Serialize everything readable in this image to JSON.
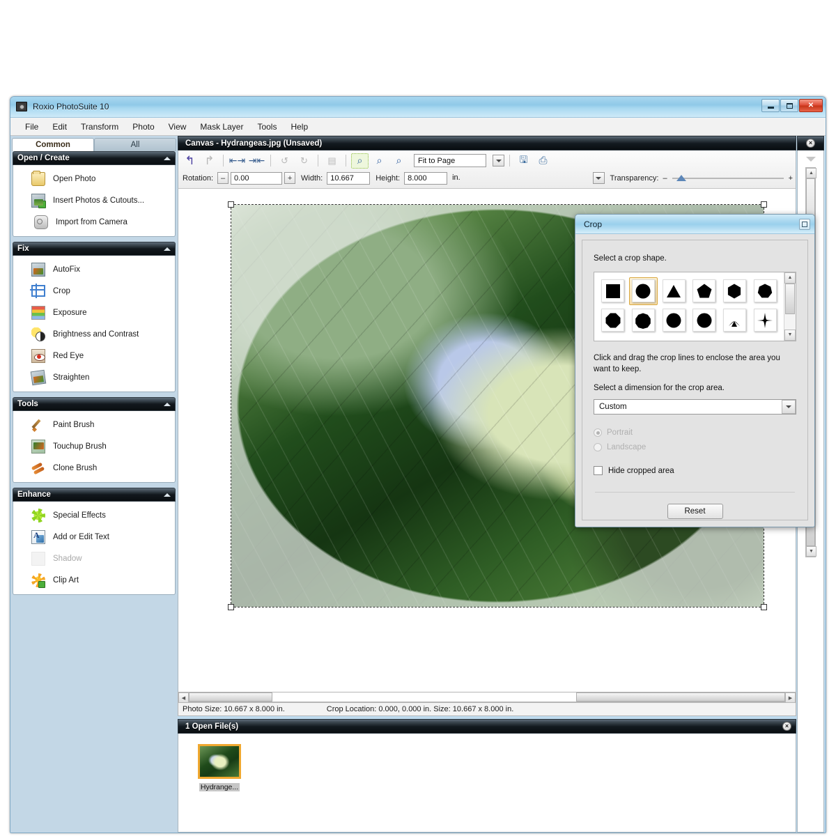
{
  "window": {
    "title": "Roxio PhotoSuite 10",
    "buttons": {
      "minimize": "minimize",
      "maximize": "maximize",
      "close": "x"
    }
  },
  "menubar": {
    "items": [
      "File",
      "Edit",
      "Transform",
      "Photo",
      "View",
      "Mask Layer",
      "Tools",
      "Help"
    ]
  },
  "sidebar": {
    "tabs": [
      {
        "label": "Common",
        "active": true
      },
      {
        "label": "All",
        "active": false
      }
    ],
    "sections": [
      {
        "title": "Open / Create",
        "items": [
          {
            "label": "Open Photo",
            "icon": "folder-icon",
            "disabled": false
          },
          {
            "label": "Insert Photos & Cutouts...",
            "icon": "photo-plus-icon",
            "disabled": false
          },
          {
            "label": "Import from Camera",
            "icon": "camera-icon",
            "disabled": false
          }
        ]
      },
      {
        "title": "Fix",
        "items": [
          {
            "label": "AutoFix",
            "icon": "autofix-icon",
            "disabled": false
          },
          {
            "label": "Crop",
            "icon": "crop-icon",
            "disabled": false
          },
          {
            "label": "Exposure",
            "icon": "exposure-icon",
            "disabled": false
          },
          {
            "label": "Brightness and Contrast",
            "icon": "brightness-icon",
            "disabled": false
          },
          {
            "label": "Red Eye",
            "icon": "red-eye-icon",
            "disabled": false
          },
          {
            "label": "Straighten",
            "icon": "straighten-icon",
            "disabled": false
          }
        ]
      },
      {
        "title": "Tools",
        "items": [
          {
            "label": "Paint Brush",
            "icon": "paint-brush-icon",
            "disabled": false
          },
          {
            "label": "Touchup Brush",
            "icon": "touchup-brush-icon",
            "disabled": false
          },
          {
            "label": "Clone Brush",
            "icon": "clone-brush-icon",
            "disabled": false
          }
        ]
      },
      {
        "title": "Enhance",
        "items": [
          {
            "label": "Special Effects",
            "icon": "special-effects-icon",
            "disabled": false
          },
          {
            "label": "Add or Edit Text",
            "icon": "add-text-icon",
            "disabled": false
          },
          {
            "label": "Shadow",
            "icon": "shadow-icon",
            "disabled": true
          },
          {
            "label": "Clip Art",
            "icon": "clip-art-icon",
            "disabled": false
          }
        ]
      }
    ]
  },
  "canvas": {
    "header_title": "Canvas - Hydrangeas.jpg (Unsaved)",
    "toolbar": {
      "undo": "undo-icon",
      "redo": "redo-icon",
      "flip_horizontal": "flip-horizontal-icon",
      "flip_vertical": "flip-vertical-icon",
      "rotate_left": "rotate-left-icon",
      "rotate_right": "rotate-right-icon",
      "align": "align-icon",
      "zoom_selection": "zoom-selection-icon",
      "zoom_in": "zoom-in-icon",
      "zoom_out": "zoom-out-icon",
      "zoom_level": "Fit to Page",
      "save": "save-icon",
      "print": "print-icon"
    },
    "properties": {
      "rotation_label": "Rotation:",
      "rotation_minus": "–",
      "rotation_value": "0.00",
      "rotation_plus": "+",
      "width_label": "Width:",
      "width_value": "10.667",
      "height_label": "Height:",
      "height_value": "8.000",
      "units_value": "in.",
      "transparency_label": "Transparency:",
      "transparency_minus": "–",
      "transparency_plus": "+"
    }
  },
  "statusbar": {
    "photo_size": "Photo Size: 10.667 x 8.000 in.",
    "crop_location": "Crop Location: 0.000, 0.000 in. Size: 10.667 x 8.000 in."
  },
  "open_files": {
    "header_title": "1 Open File(s)",
    "close_glyph": "×",
    "files": [
      {
        "label": "Hydrange...",
        "selected": true
      }
    ]
  },
  "right_panel": {
    "close_glyph": "×"
  },
  "crop_dialog": {
    "title": "Crop",
    "shape_prompt": "Select a crop shape.",
    "shapes": [
      {
        "name": "square",
        "selected": false
      },
      {
        "name": "circle",
        "selected": true
      },
      {
        "name": "triangle",
        "selected": false
      },
      {
        "name": "pentagon",
        "selected": false
      },
      {
        "name": "hexagon",
        "selected": false
      },
      {
        "name": "heptagon",
        "selected": false
      },
      {
        "name": "octagon",
        "selected": false
      },
      {
        "name": "nonagon",
        "selected": false
      },
      {
        "name": "decagon",
        "selected": false
      },
      {
        "name": "dodecagon",
        "selected": false
      },
      {
        "name": "fan",
        "selected": false
      },
      {
        "name": "star-cross",
        "selected": false
      }
    ],
    "instructions": "Click and drag the crop lines to enclose the area you want to keep.",
    "dimension_prompt": "Select a dimension for the crop area.",
    "dimension_value": "Custom",
    "orientation": [
      {
        "label": "Portrait",
        "selected": true,
        "disabled": true
      },
      {
        "label": "Landscape",
        "selected": false,
        "disabled": true
      }
    ],
    "hide_cropped_label": "Hide cropped area",
    "hide_cropped_checked": false,
    "reset_label": "Reset"
  },
  "colors": {
    "title_blue": "#a9d7ef",
    "accent_orange": "#f0a830",
    "panel_dark": "#131a20",
    "sidebar_blue": "#c3d7e6",
    "close_red": "#de4a34"
  }
}
